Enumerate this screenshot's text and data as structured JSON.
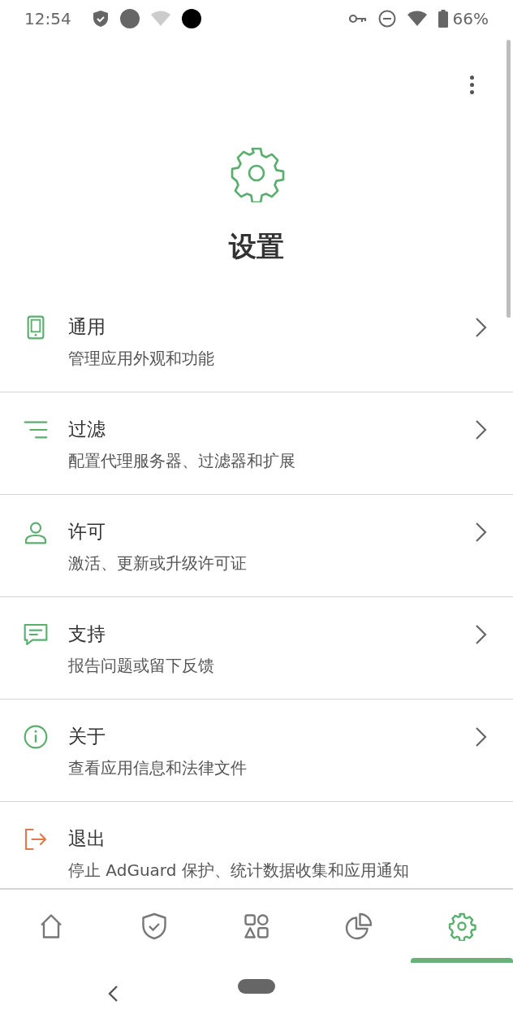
{
  "status_bar": {
    "time": "12:54",
    "battery": "66%"
  },
  "header": {
    "title": "设置"
  },
  "items": [
    {
      "kind": "phone",
      "title": "通用",
      "subtitle": "管理应用外观和功能",
      "color": "#5aae6e",
      "chevron": true
    },
    {
      "kind": "filter",
      "title": "过滤",
      "subtitle": "配置代理服务器、过滤器和扩展",
      "color": "#5aae6e",
      "chevron": true
    },
    {
      "kind": "person",
      "title": "许可",
      "subtitle": "激活、更新或升级许可证",
      "color": "#5aae6e",
      "chevron": true
    },
    {
      "kind": "chat",
      "title": "支持",
      "subtitle": "报告问题或留下反馈",
      "color": "#5aae6e",
      "chevron": true
    },
    {
      "kind": "info",
      "title": "关于",
      "subtitle": "查看应用信息和法律文件",
      "color": "#5aae6e",
      "chevron": true
    },
    {
      "kind": "exit",
      "title": "退出",
      "subtitle": "停止 AdGuard 保护、统计数据收集和应用通知",
      "color": "#e07a4a",
      "chevron": false
    }
  ],
  "bottom_nav": [
    {
      "kind": "home",
      "selected": false
    },
    {
      "kind": "shield",
      "selected": false
    },
    {
      "kind": "apps",
      "selected": false
    },
    {
      "kind": "stats",
      "selected": false
    },
    {
      "kind": "settings",
      "selected": true
    }
  ]
}
